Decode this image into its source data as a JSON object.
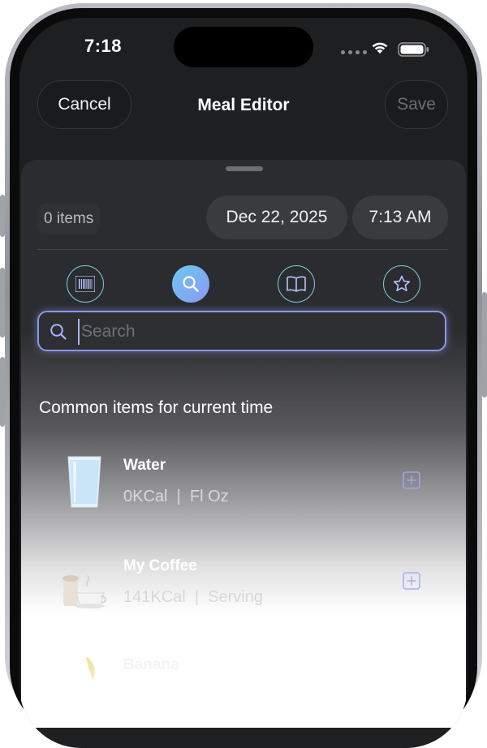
{
  "status_bar": {
    "time": "7:18"
  },
  "nav": {
    "cancel_label": "Cancel",
    "title": "Meal Editor",
    "save_label": "Save"
  },
  "meta": {
    "items_count": "0 items",
    "date": "Dec 22, 2025",
    "time": "7:13 AM"
  },
  "modes": [
    {
      "name": "barcode",
      "icon": "barcode-icon",
      "active": false
    },
    {
      "name": "search",
      "icon": "search-icon",
      "active": true
    },
    {
      "name": "library",
      "icon": "book-icon",
      "active": false
    },
    {
      "name": "favorites",
      "icon": "star-icon",
      "active": false
    }
  ],
  "search": {
    "placeholder": "Search",
    "value": ""
  },
  "common": {
    "title": "Common items for current time",
    "items": [
      {
        "name": "Water",
        "calories": "0KCal",
        "unit": "Fl Oz"
      },
      {
        "name": "My Coffee",
        "calories": "141KCal",
        "unit": "Serving"
      },
      {
        "name": "Banana"
      }
    ]
  },
  "colors": {
    "accent": "#8a95e8",
    "icon_teal": "#7cc4dd",
    "background": "#2b2c2f"
  }
}
